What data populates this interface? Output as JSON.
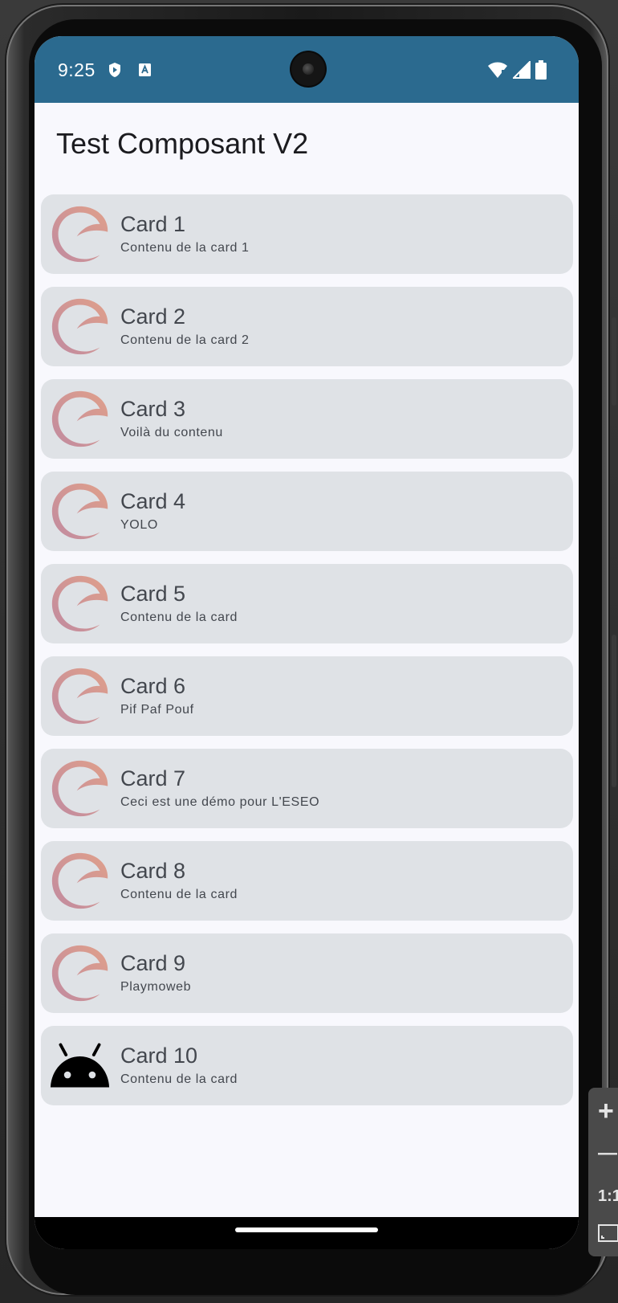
{
  "statusbar": {
    "time": "9:25"
  },
  "app": {
    "title": "Test Composant V2"
  },
  "cards": [
    {
      "title": "Card 1",
      "subtitle": "Contenu de la card 1",
      "icon": "swirl-logo-icon"
    },
    {
      "title": "Card 2",
      "subtitle": "Contenu de la card 2",
      "icon": "swirl-logo-icon"
    },
    {
      "title": "Card 3",
      "subtitle": "Voilà du contenu",
      "icon": "swirl-logo-icon"
    },
    {
      "title": "Card 4",
      "subtitle": "YOLO",
      "icon": "swirl-logo-icon"
    },
    {
      "title": "Card 5",
      "subtitle": "Contenu de la card",
      "icon": "swirl-logo-icon"
    },
    {
      "title": "Card 6",
      "subtitle": "Pif Paf Pouf",
      "icon": "swirl-logo-icon"
    },
    {
      "title": "Card 7",
      "subtitle": "Ceci est une démo pour L'ESEO",
      "icon": "swirl-logo-icon"
    },
    {
      "title": "Card 8",
      "subtitle": "Contenu de la card",
      "icon": "swirl-logo-icon"
    },
    {
      "title": "Card 9",
      "subtitle": "Playmoweb",
      "icon": "swirl-logo-icon"
    },
    {
      "title": "Card 10",
      "subtitle": "Contenu de la card",
      "icon": "android-icon"
    }
  ],
  "toolbar": {
    "zoom_in": "+",
    "zoom_out": "—",
    "zoom_label": "1:1"
  },
  "colors": {
    "statusbar": "#2b6a8f",
    "card_background": "#dfe2e6",
    "screen_background": "#f8f8fd",
    "card_text": "#43474e",
    "logo_gradient_start": "#c08aa0",
    "logo_gradient_end": "#e0a08a"
  }
}
